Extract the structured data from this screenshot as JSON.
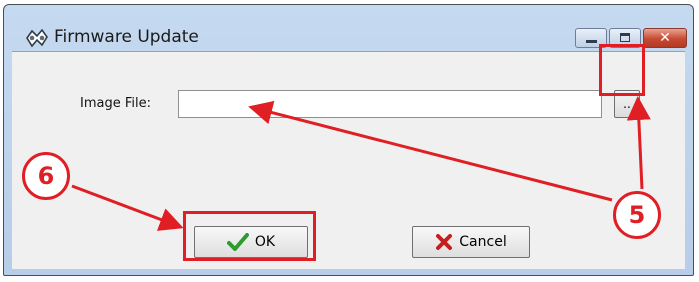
{
  "window": {
    "title": "Firmware Update",
    "controls": {
      "minimize": "minimize",
      "maximize": "maximize",
      "close_glyph": "✕"
    }
  },
  "form": {
    "image_file_label": "Image File:",
    "image_file_value": "",
    "browse_label": ".."
  },
  "buttons": {
    "ok_label": "OK",
    "cancel_label": "Cancel"
  },
  "annotations": {
    "callout_a": "6",
    "callout_b": "5",
    "accent_color": "#e01f25"
  },
  "icons": {
    "app": "firmware-gear-icon",
    "ok": "green-checkmark-icon",
    "cancel": "red-x-icon"
  }
}
